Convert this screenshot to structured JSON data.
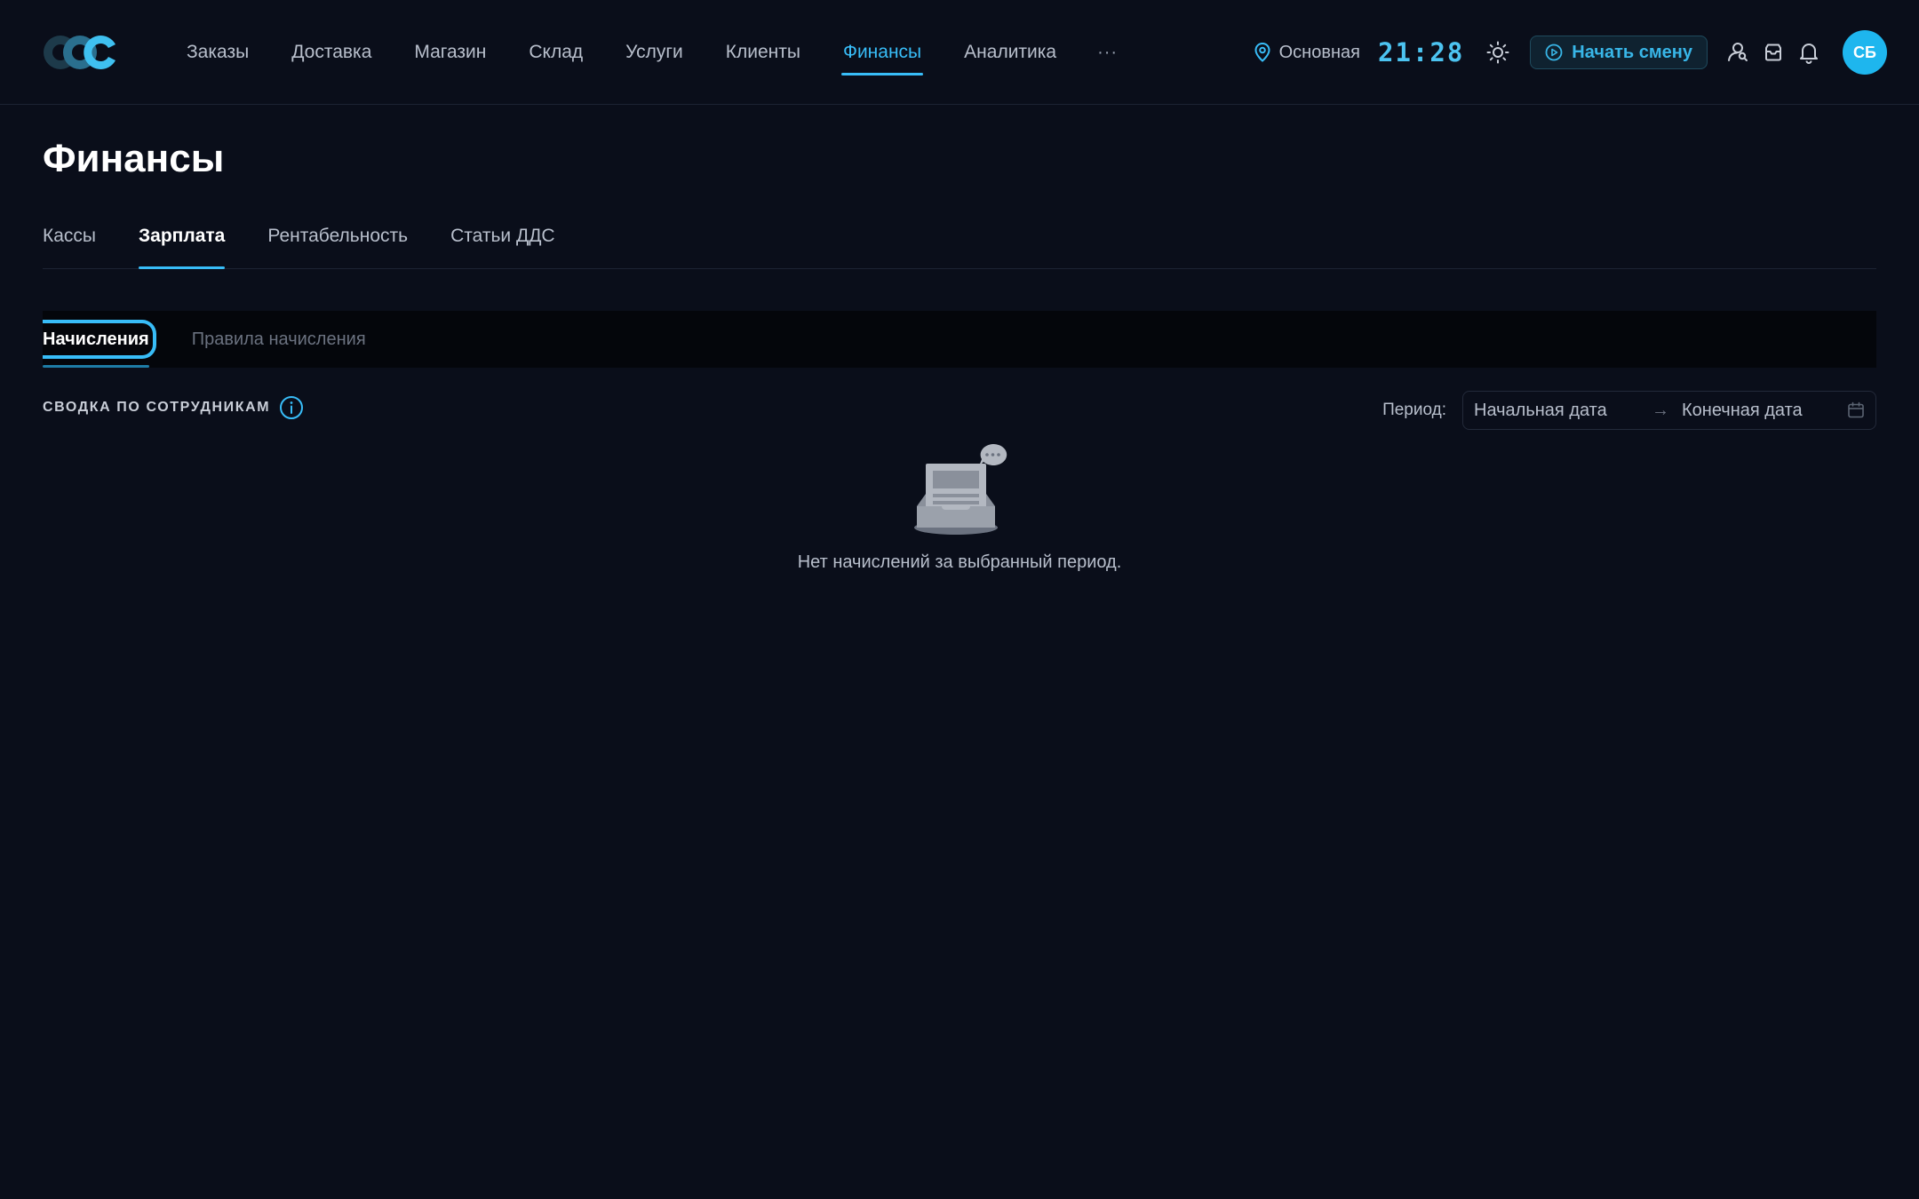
{
  "header": {
    "logo": "ccc-logo",
    "nav": [
      {
        "label": "Заказы"
      },
      {
        "label": "Доставка"
      },
      {
        "label": "Магазин"
      },
      {
        "label": "Склад"
      },
      {
        "label": "Услуги"
      },
      {
        "label": "Клиенты"
      },
      {
        "label": "Финансы",
        "active": true
      },
      {
        "label": "Аналитика"
      }
    ],
    "more": "···",
    "location": "Основная",
    "clock": "21:28",
    "start_shift": "Начать смену",
    "avatar_initials": "СБ"
  },
  "page": {
    "title": "Финансы",
    "tabs": [
      {
        "label": "Кассы"
      },
      {
        "label": "Зарплата",
        "active": true
      },
      {
        "label": "Рентабельность"
      },
      {
        "label": "Статьи ДДС"
      }
    ],
    "subtabs": [
      {
        "label": "Начисления",
        "active": true
      },
      {
        "label": "Правила начисления"
      }
    ],
    "summary_label": "СВОДКА ПО СОТРУДНИКАМ",
    "period": {
      "label": "Период:",
      "start_placeholder": "Начальная дата",
      "end_placeholder": "Конечная дата",
      "arrow": "→"
    },
    "empty_text": "Нет начислений за выбранный период."
  },
  "colors": {
    "background": "#0a0e1a",
    "accent": "#38bdf8",
    "avatar": "#1eb6ee"
  }
}
